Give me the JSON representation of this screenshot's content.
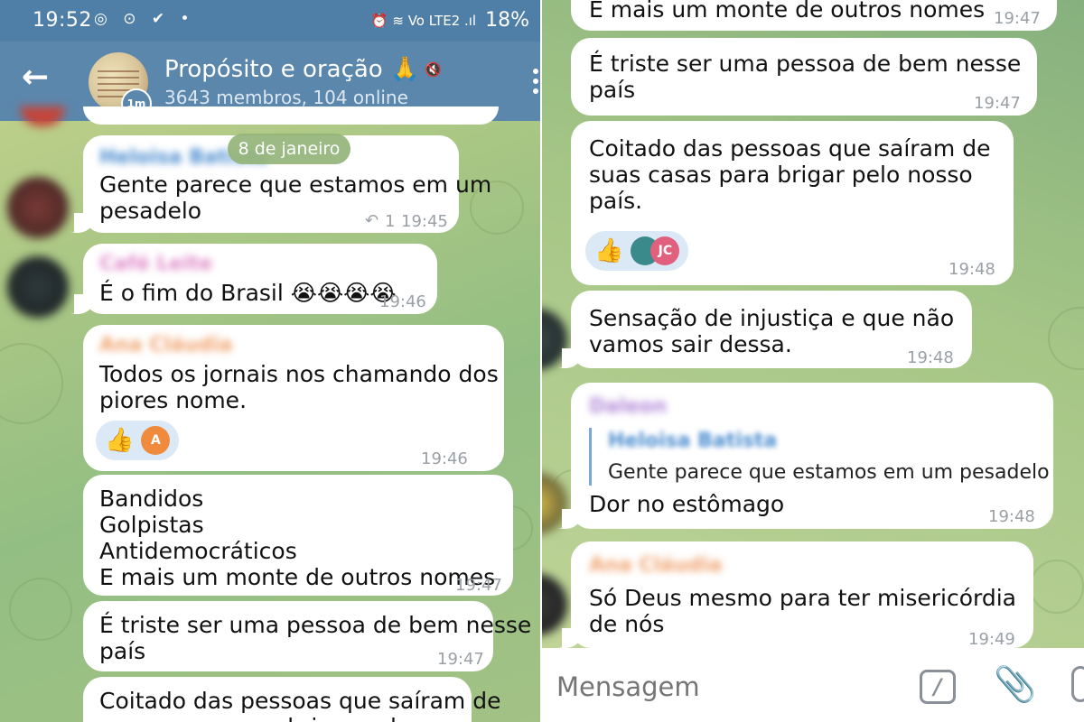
{
  "status": {
    "time": "19:52",
    "battery": "18%",
    "left_icons": "◎ ⊙ ✔ •",
    "right_icons": "⏰ ≋ Vo LTE2 .ıl"
  },
  "chat": {
    "title": "Propósito e oração 🙏",
    "subtitle": "3643 membros, 104 online",
    "timer": "1m"
  },
  "date_pill": "8 de janeiro",
  "left_messages": [
    {
      "sender": "Heloisa Batista",
      "text": "Gente parece que estamos em um\npesadelo",
      "reply_count": "1",
      "time": "19:45"
    },
    {
      "sender": "Café Leite",
      "text": "É o fim do Brasil 😭😭😭😭",
      "time": "19:46"
    },
    {
      "sender": "Ana Cláudia",
      "text": "Todos os jornais nos chamando dos\npiores nome.",
      "time": "19:46",
      "reaction": "👍",
      "reactor": "A"
    },
    {
      "text": "Bandidos\nGolpistas\nAntidemocráticos\nE mais um monte de outros nomes",
      "time": "19:47"
    },
    {
      "text": "É triste ser uma pessoa de bem nesse\npaís",
      "time": "19:47"
    },
    {
      "text": "Coitado das pessoas que saíram de\nsuas casas para brigar pelo nosso"
    }
  ],
  "right_messages": [
    {
      "text": "E mais um monte de outros nomes",
      "time": "19:47"
    },
    {
      "text": "É triste ser uma pessoa de bem nesse\npaís",
      "time": "19:47"
    },
    {
      "text": "Coitado das pessoas que saíram de\nsuas casas para brigar pelo nosso\npaís.",
      "time": "19:48",
      "reaction": "👍",
      "reactor": "JC"
    },
    {
      "text": "Sensação de injustiça e que não\nvamos sair dessa.",
      "time": "19:48"
    },
    {
      "sender": "Daleon",
      "quote_sender": "Heloisa Batista",
      "quote_text": "Gente parece que estamos em um pesadelo",
      "text": "Dor no estômago",
      "time": "19:48"
    },
    {
      "sender": "Ana Cláudia",
      "text": "Só Deus mesmo para ter misericórdia\nde nós",
      "time": "19:49"
    }
  ],
  "composer": {
    "placeholder": "Mensagem",
    "command_icon": "/",
    "attach_icon": "📎"
  },
  "colors": {
    "header": "#5b87ad",
    "statusbar": "#4f7ea6",
    "bubble": "#ffffff",
    "reaction_bg": "#dbe9f6"
  }
}
